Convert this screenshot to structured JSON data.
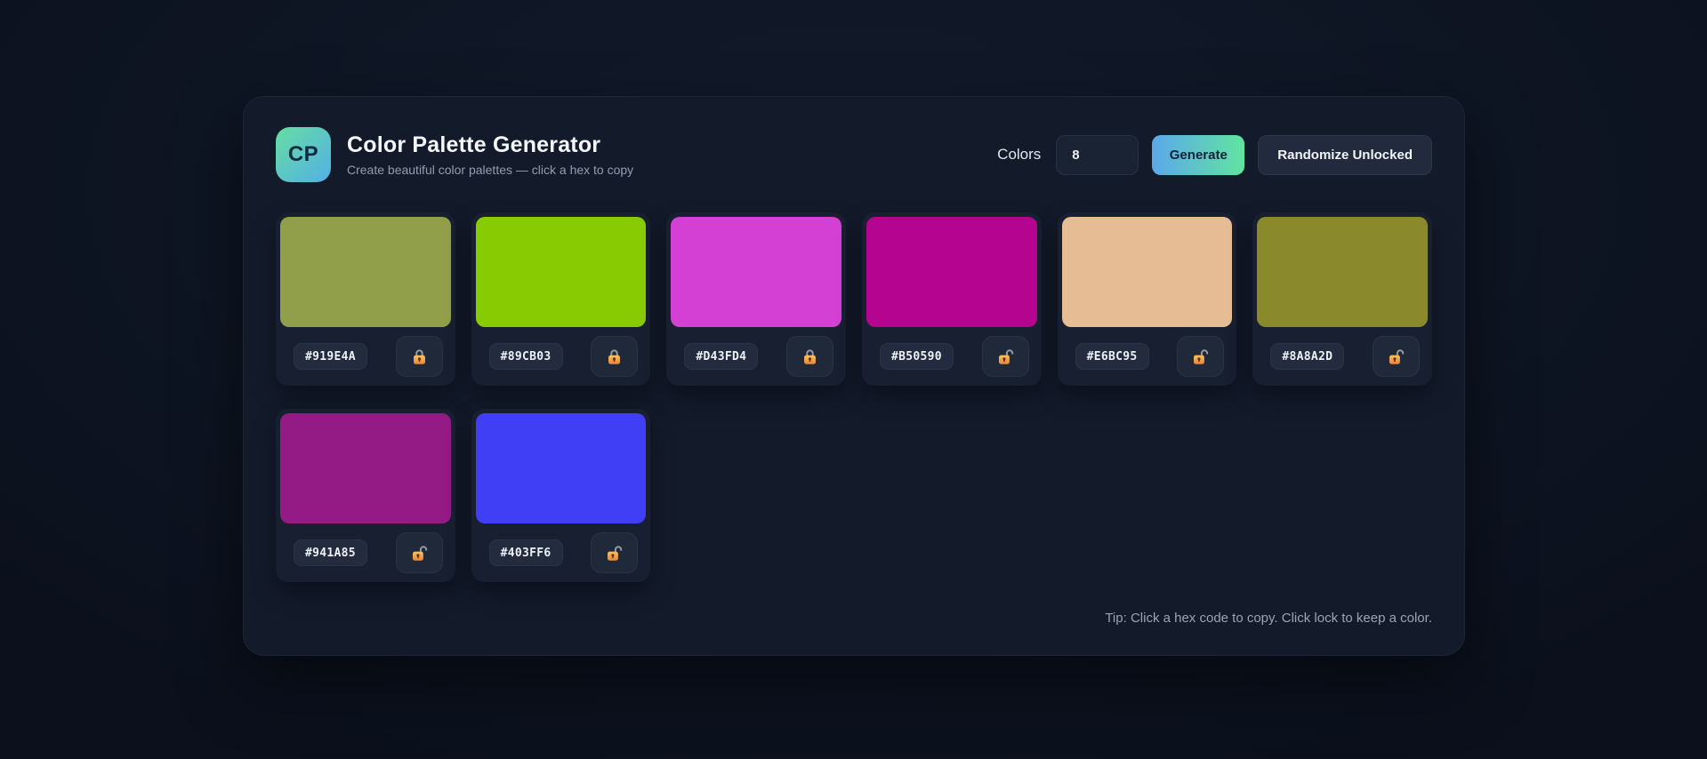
{
  "app": {
    "logo_text": "CP",
    "title": "Color Palette Generator",
    "subtitle": "Create beautiful color palettes — click a hex to copy",
    "tip": "Tip: Click a hex code to copy. Click lock to keep a color."
  },
  "controls": {
    "colors_label": "Colors",
    "colors_count": "8",
    "generate_label": "Generate",
    "randomize_label": "Randomize Unlocked"
  },
  "theme": {
    "page_bg": "#0e1523",
    "card_bg": "#131a2a",
    "swatch_card_bg": "#171f30",
    "accent_gradient_start": "#5ba8ea",
    "accent_gradient_end": "#62e3a1",
    "logo_gradient_start": "#66dda2",
    "logo_gradient_end": "#53b0e6",
    "lock_icon_color": "#f2a447"
  },
  "palette": [
    {
      "hex": "#919E4A",
      "locked": true,
      "lock_icon": "lock-closed-icon"
    },
    {
      "hex": "#89CB03",
      "locked": true,
      "lock_icon": "lock-closed-icon"
    },
    {
      "hex": "#D43FD4",
      "locked": true,
      "lock_icon": "lock-closed-icon"
    },
    {
      "hex": "#B50590",
      "locked": false,
      "lock_icon": "lock-open-icon"
    },
    {
      "hex": "#E6BC95",
      "locked": false,
      "lock_icon": "lock-open-icon"
    },
    {
      "hex": "#8A8A2D",
      "locked": false,
      "lock_icon": "lock-open-icon"
    },
    {
      "hex": "#941A85",
      "locked": false,
      "lock_icon": "lock-open-icon"
    },
    {
      "hex": "#403FF6",
      "locked": false,
      "lock_icon": "lock-open-icon"
    }
  ]
}
